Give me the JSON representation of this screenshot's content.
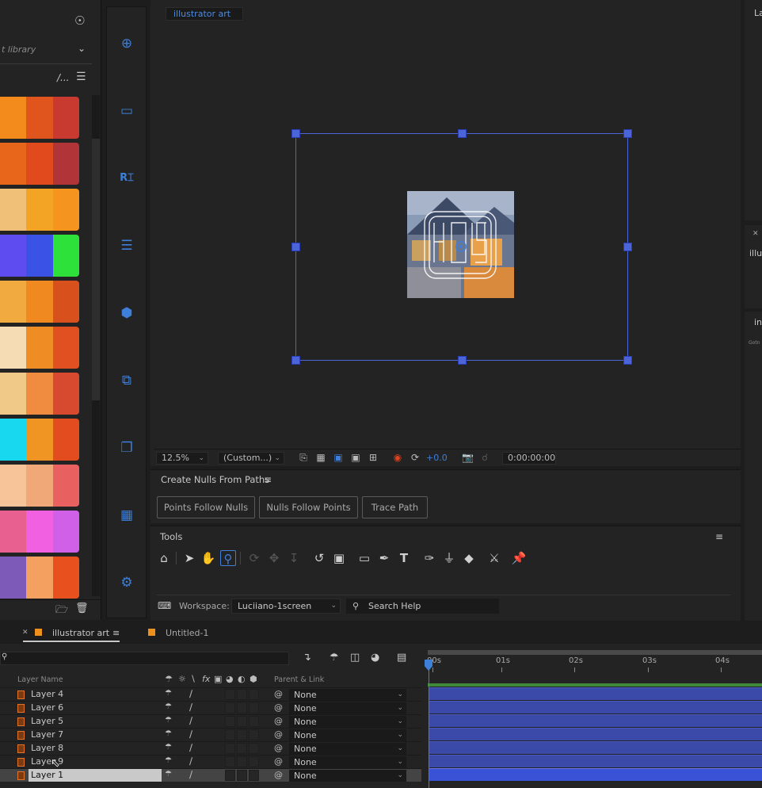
{
  "library": {
    "dropdown_label": "t library",
    "sort_label": "/...",
    "swatches": [
      [
        "#f28a1c",
        "#e0541e",
        "#c8392f"
      ],
      [
        "#e8661c",
        "#e04a1c",
        "#b03438"
      ],
      [
        "#f0c078",
        "#f4a424",
        "#f59520"
      ],
      [
        "#5e4cf0",
        "#3a52e6",
        "#2ee03a"
      ],
      [
        "#f0aa40",
        "#f08a20",
        "#d8501c"
      ],
      [
        "#f6dcb4",
        "#f08c24",
        "#e05020"
      ],
      [
        "#f0c888",
        "#f08c40",
        "#d84a30"
      ],
      [
        "#18d8f0",
        "#f09424",
        "#e24c1e"
      ],
      [
        "#f6c498",
        "#f0a878",
        "#e86060"
      ],
      [
        "#e86090",
        "#f060e0",
        "#d060e8"
      ],
      [
        "#7e5ab8",
        "#f4a060",
        "#e8501e"
      ]
    ]
  },
  "strip_icons": [
    "add-circle-icon",
    "trash-icon",
    "rename-icon",
    "align-icon",
    "cube-icon",
    "duplicate-icon",
    "copy-icon",
    "grid-add-icon",
    "gear-icon"
  ],
  "viewer": {
    "tab_label": "illustrator art",
    "zoom": "12.5%",
    "view_mode": "(Custom...)",
    "exposure": "+0.0",
    "timecode": "0:00:00:00"
  },
  "nulls_panel": {
    "title": "Create Nulls From Paths",
    "buttons": [
      "Points Follow Nulls",
      "Nulls Follow Points",
      "Trace Path"
    ]
  },
  "tools_panel": {
    "title": "Tools",
    "workspace_label": "Workspace:",
    "workspace_value": "Luciiano-1screen",
    "search_placeholder": "Search Help"
  },
  "right_panels": {
    "top_label": "La",
    "mid_label": "illu",
    "lower_label": "in",
    "lower_tiny": "Gotn"
  },
  "timeline": {
    "tabs": [
      {
        "label": "illustrator art",
        "color": "#f0901c",
        "active": true
      },
      {
        "label": "Untitled-1",
        "color": "#f0901c",
        "active": false
      }
    ],
    "header": {
      "layer_name": "Layer Name",
      "parent_link": "Parent & Link"
    },
    "ruler_labels": [
      "00s",
      "01s",
      "02s",
      "03s",
      "04s"
    ],
    "layers": [
      {
        "name": "Layer 4",
        "parent": "None",
        "selected": false
      },
      {
        "name": "Layer 6",
        "parent": "None",
        "selected": false
      },
      {
        "name": "Layer 5",
        "parent": "None",
        "selected": false
      },
      {
        "name": "Layer 7",
        "parent": "None",
        "selected": false
      },
      {
        "name": "Layer 8",
        "parent": "None",
        "selected": false
      },
      {
        "name": "Layer 9",
        "parent": "None",
        "selected": false
      },
      {
        "name": "Layer 1",
        "parent": "None",
        "selected": true
      }
    ]
  },
  "colors": {
    "accent": "#3d7fd9",
    "selection": "#4b64d8",
    "layer_bar": "#3b4aa8",
    "label_orange": "#f0901c"
  }
}
